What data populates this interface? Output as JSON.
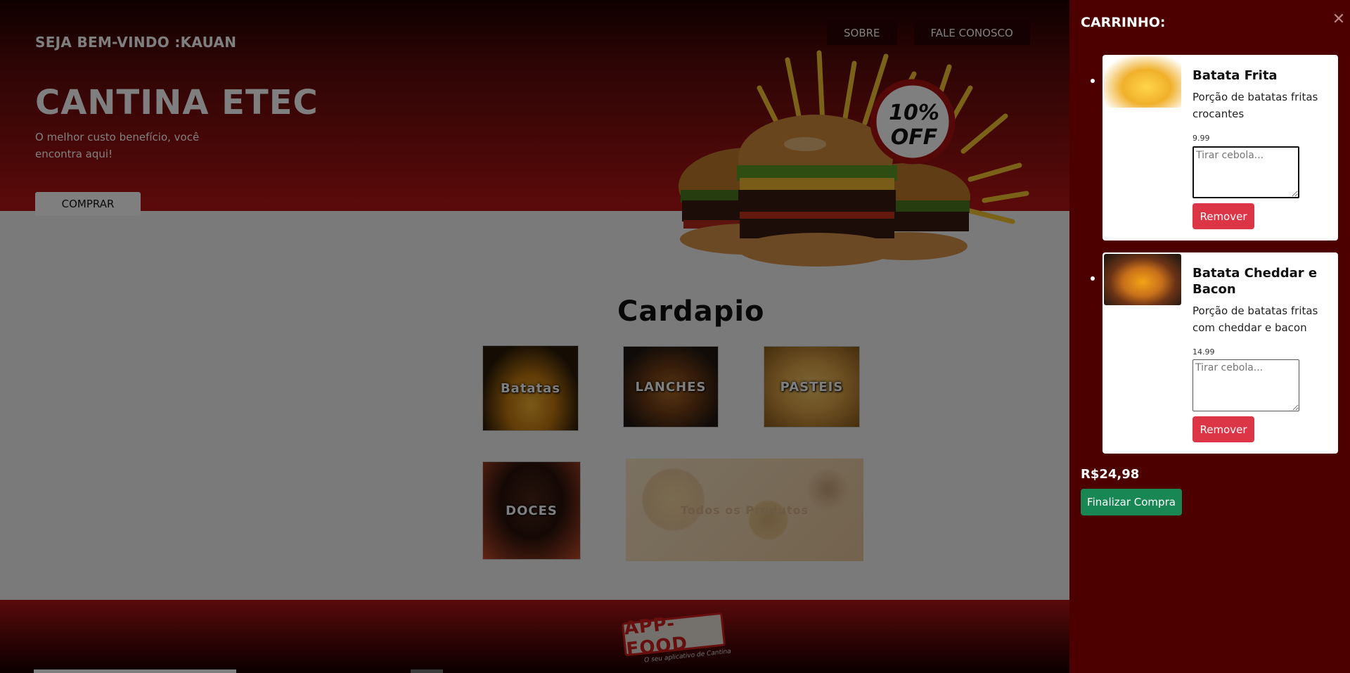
{
  "header": {
    "welcome": "SEJA BEM-VINDO :KAUAN",
    "nav": [
      {
        "label": "SOBRE"
      },
      {
        "label": "FALE CONOSCO"
      }
    ]
  },
  "hero": {
    "title": "CANTINA ETEC",
    "subtitle": "O melhor custo benefício, você encontra aqui!",
    "buy_label": "COMPRAR",
    "promo_line1": "10%",
    "promo_line2": "OFF"
  },
  "menu": {
    "title": "Cardapio",
    "categories": [
      {
        "label": "Batatas"
      },
      {
        "label": "LANCHES"
      },
      {
        "label": "PASTEIS"
      },
      {
        "label": "DOCES"
      },
      {
        "label": "Todos os Produtos"
      }
    ]
  },
  "footer": {
    "logo": "APP-FOOD",
    "tagline": "O seu aplicativo de Cantina"
  },
  "cart": {
    "title": "CARRINHO:",
    "close_icon": "close-icon",
    "items": [
      {
        "name": "Batata Frita",
        "description": "Porção de batatas fritas crocantes",
        "price": "9.99",
        "note_placeholder": "Tirar cebola...",
        "remove_label": "Remover"
      },
      {
        "name": "Batata Cheddar e Bacon",
        "description": "Porção de batatas fritas com cheddar e bacon",
        "price": "14.99",
        "note_placeholder": "Tirar cebola...",
        "remove_label": "Remover"
      }
    ],
    "total": "R$24,98",
    "finish_label": "Finalizar Compra"
  },
  "colors": {
    "cart_bg": "#4d0000",
    "remove_button": "#dc3545",
    "finish_button": "#198754",
    "brand_red": "#b81414"
  }
}
